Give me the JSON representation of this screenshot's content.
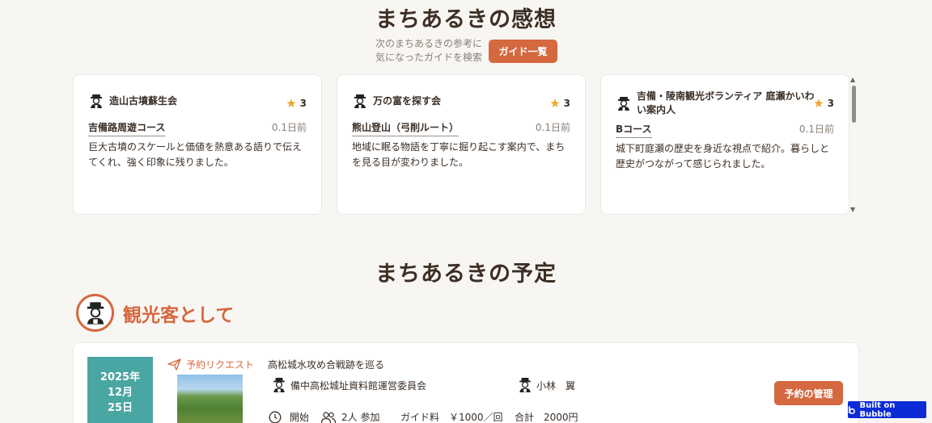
{
  "feedback": {
    "title": "まちあるきの感想",
    "hint_line1": "次のまちあるきの参考に",
    "hint_line2": "気になったガイドを検索",
    "guide_list_button": "ガイド一覧",
    "reviews": [
      {
        "guide": "造山古墳蘇生会",
        "rating": "3",
        "course": "吉備路周遊コース",
        "ago": "0.1日前",
        "text": "巨大古墳のスケールと価値を熱意ある語りで伝えてくれ、強く印象に残りました。"
      },
      {
        "guide": "万の富を探す会",
        "rating": "3",
        "course": "熊山登山（弓削ルート）",
        "ago": "0.1日前",
        "text": "地域に眠る物語を丁寧に掘り起こす案内で、まちを見る目が変わりました。"
      },
      {
        "guide": "吉備・陵南観光ボランティア 庭瀬かいわい案内人",
        "rating": "3",
        "course": "Bコース",
        "ago": "0.1日前",
        "text": "城下町庭瀬の歴史を身近な視点で紹介。暮らしと歴史がつながって感じられました。"
      }
    ]
  },
  "schedule": {
    "title": "まちあるきの予定",
    "role_label": "観光客として",
    "booking": {
      "date_year": "2025年",
      "date_month": "12月",
      "date_day": "25日",
      "status": "予約リクエスト",
      "tour_title": "高松城水攻め合戦跡を巡る",
      "organization": "備中高松城址資料館運営委員会",
      "guide_person": "小林　翼",
      "manage_button": "予約の管理",
      "start_label": "開始",
      "participants": "2人 参加",
      "fee_label": "ガイド料",
      "fee_value": "￥1000／回",
      "total_label": "合計",
      "total_value": "2000円"
    }
  },
  "badge": {
    "label": "Built on Bubble"
  },
  "colors": {
    "accent": "#d4683f",
    "teal": "#4aa6a2",
    "star": "#e9a52a",
    "badge": "#0c2bd6"
  }
}
